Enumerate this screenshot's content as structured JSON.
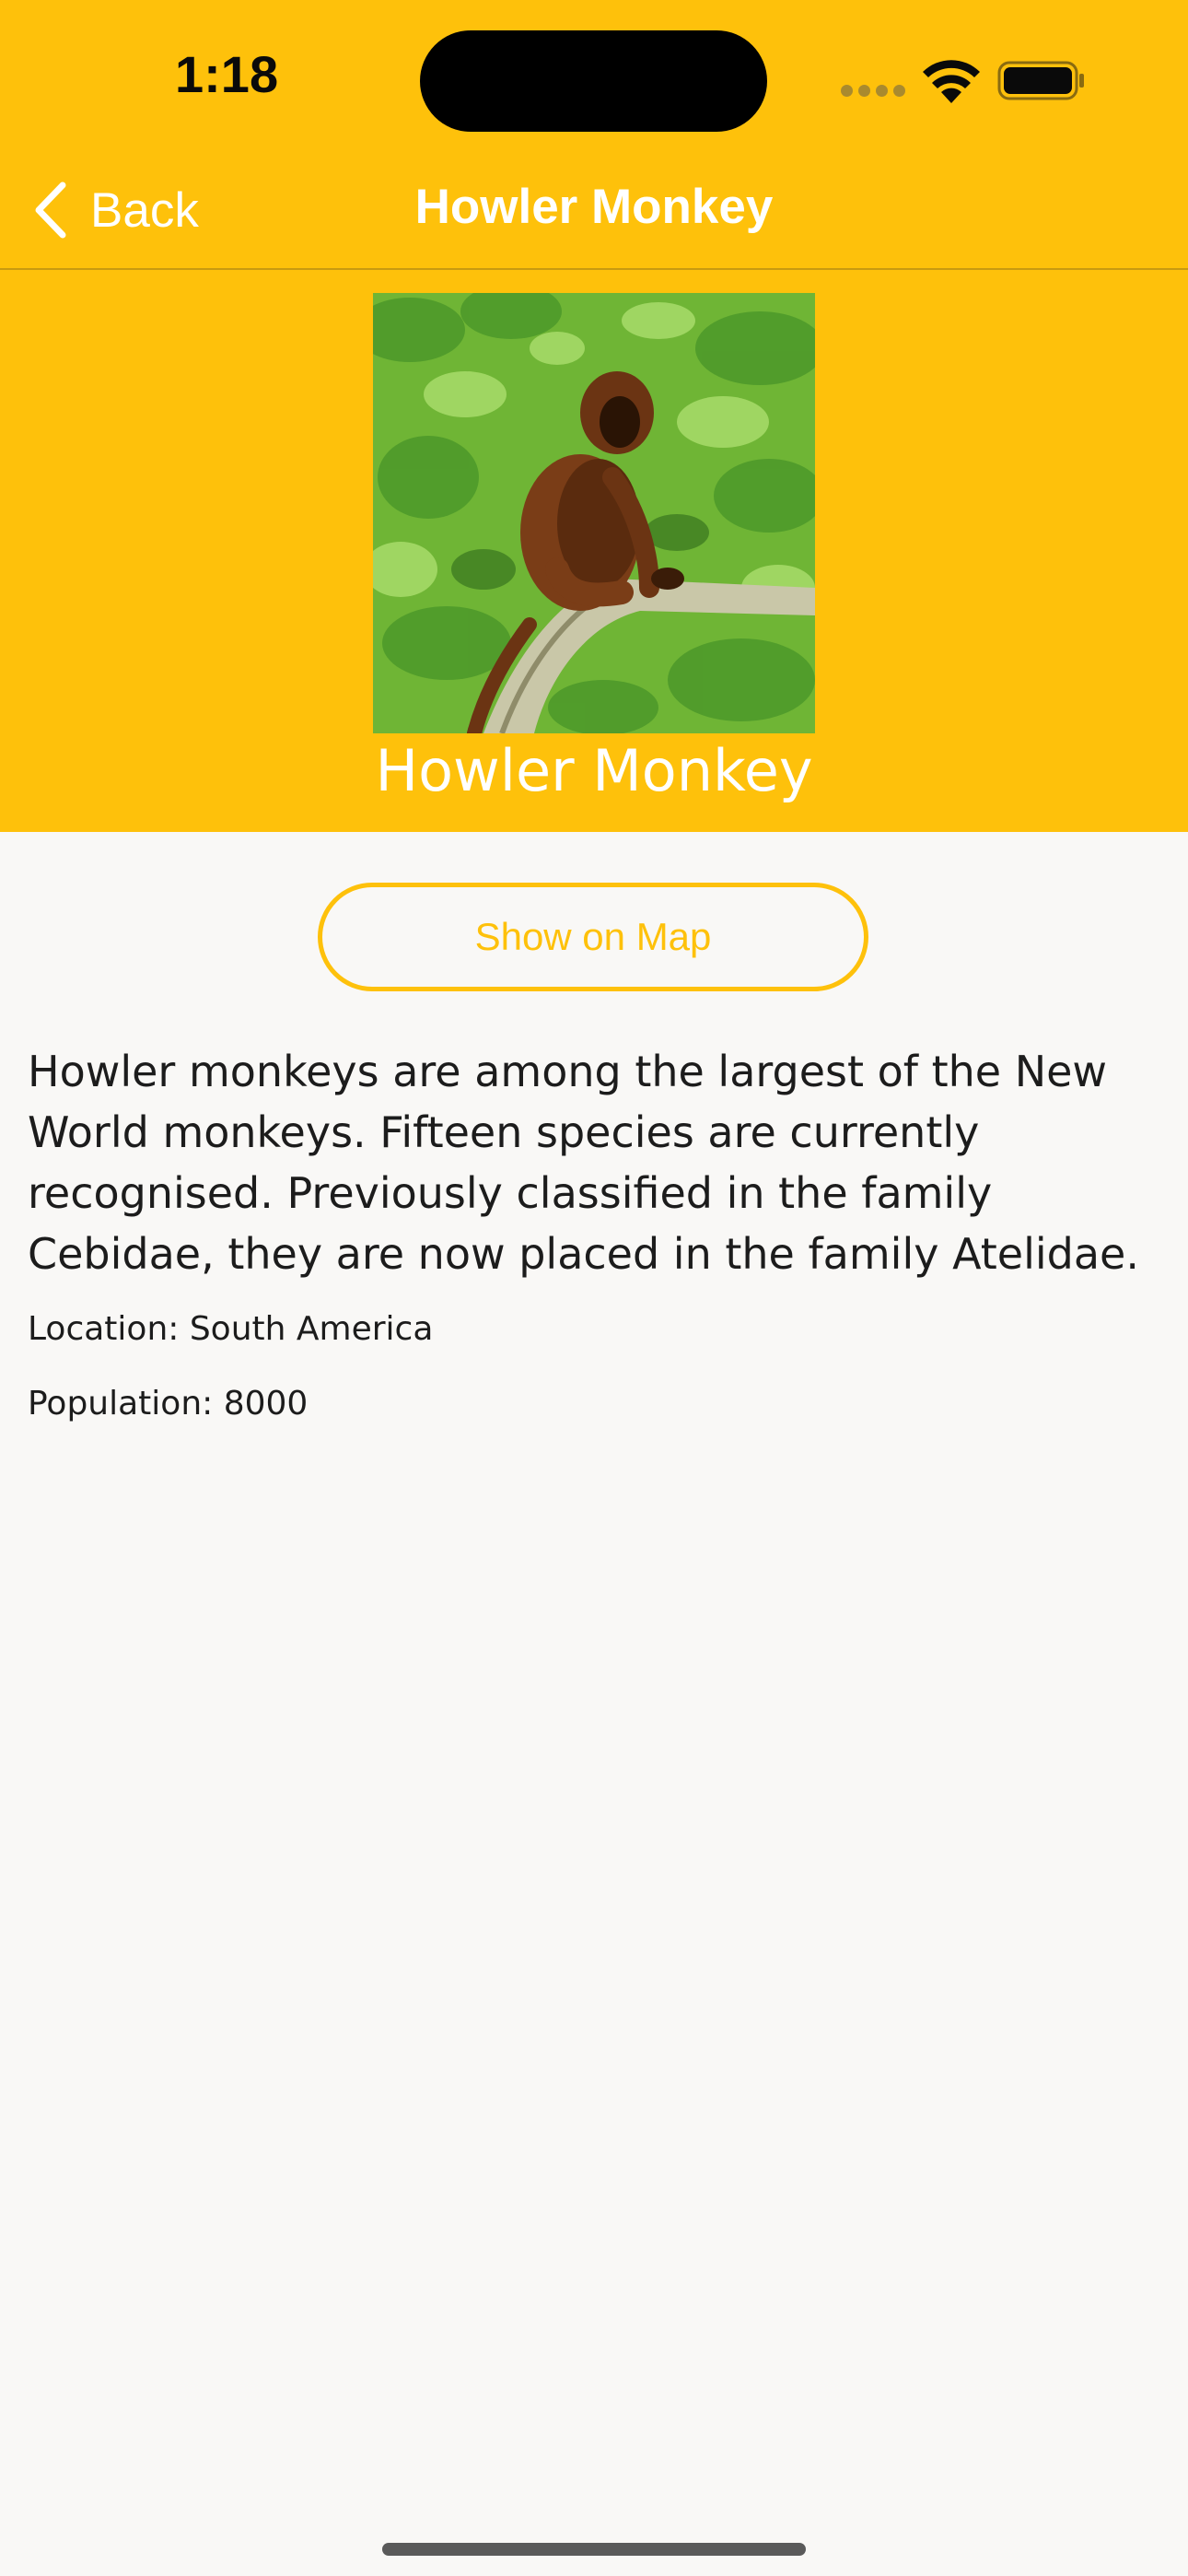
{
  "status_bar": {
    "time": "1:18"
  },
  "nav": {
    "back_label": "Back",
    "title": "Howler Monkey"
  },
  "animal": {
    "name": "Howler Monkey",
    "photo_icon": "howler-monkey-photo",
    "show_on_map_label": "Show on Map",
    "description": "Howler monkeys are among the largest of the New World monkeys. Fifteen species are currently recognised. Previously classified in the family Cebidae, they are now placed in the family Atelidae.",
    "location": "Location: South America",
    "population": "Population: 8000"
  },
  "colors": {
    "accent": "#fec10b",
    "background": "#f9f8f6",
    "text": "#1c1c1c",
    "nav_text": "#ffffff"
  }
}
